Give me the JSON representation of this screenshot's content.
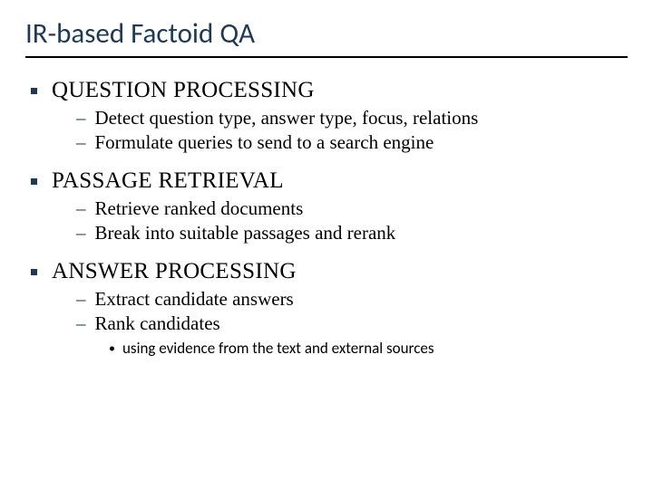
{
  "title": "IR-based Factoid QA",
  "sections": [
    {
      "heading": "QUESTION PROCESSING",
      "subs": [
        "Detect question type, answer type, focus, relations",
        "Formulate queries to send to a search engine"
      ],
      "sub2": []
    },
    {
      "heading": "PASSAGE RETRIEVAL",
      "subs": [
        "Retrieve ranked documents",
        "Break into suitable passages and rerank"
      ],
      "sub2": []
    },
    {
      "heading": "ANSWER PROCESSING",
      "subs": [
        "Extract candidate answers",
        "Rank candidates"
      ],
      "sub2": [
        "using evidence from the text and external sources"
      ]
    }
  ]
}
